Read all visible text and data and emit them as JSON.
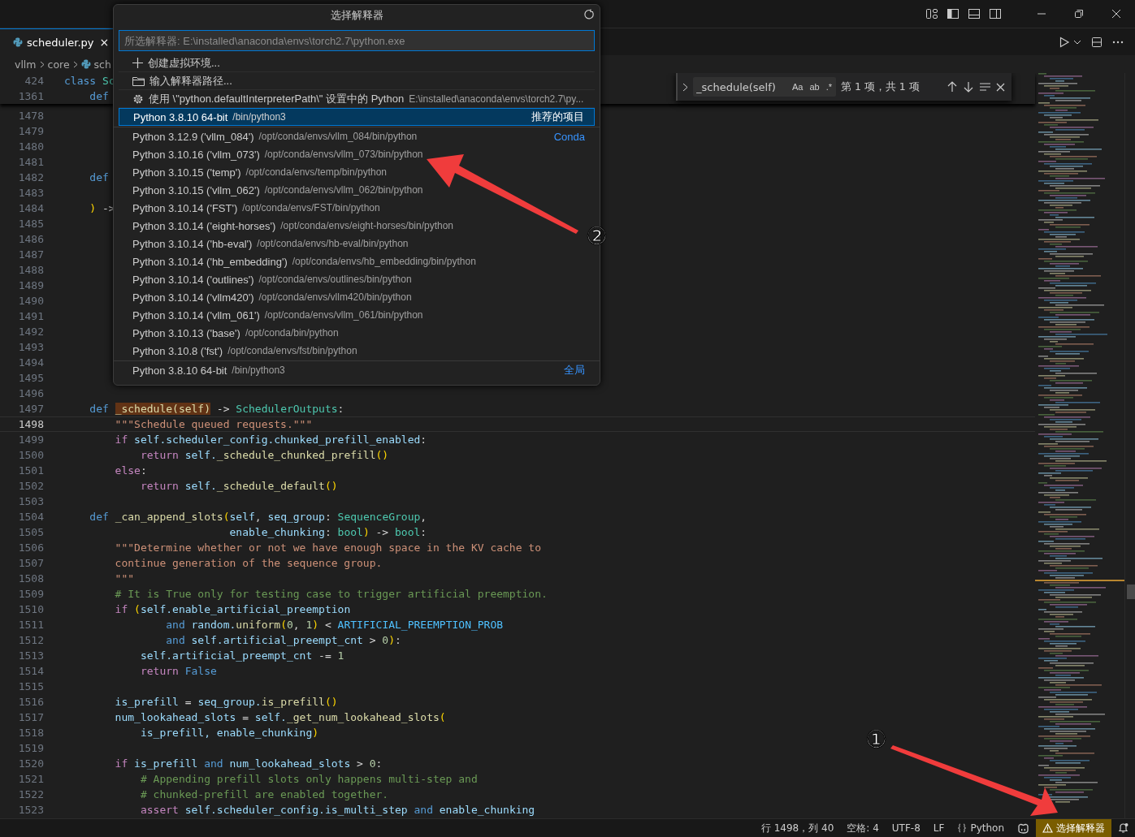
{
  "tab": {
    "label": "scheduler.py",
    "close": "×",
    "selected": true
  },
  "breadcrumbs": [
    "vllm",
    "core",
    "sch"
  ],
  "sticky": [
    {
      "n": "424",
      "tokens": [
        {
          "text": "class ",
          "kind": "kw"
        },
        {
          "text": "Sc",
          "kind": "cls"
        }
      ]
    },
    {
      "n": "1361",
      "tokens": [
        {
          "text": "    def",
          "kind": "kw"
        }
      ]
    }
  ],
  "code": {
    "lines": [
      {
        "n": "1478",
        "selected": false
      },
      {
        "n": "1479",
        "selected": false
      },
      {
        "n": "1480",
        "selected": false
      },
      {
        "n": "1481",
        "selected": false
      },
      {
        "n": "1482",
        "selected": false,
        "tokens": [
          {
            "text": "    def",
            "kind": "kw"
          }
        ]
      },
      {
        "n": "1483",
        "selected": false
      },
      {
        "n": "1484",
        "selected": false,
        "tokens": [
          {
            "text": "    )",
            "kind": "paren"
          },
          {
            "text": " ->",
            "kind": "p"
          }
        ]
      },
      {
        "n": "1485",
        "selected": false
      },
      {
        "n": "1486",
        "selected": false
      },
      {
        "n": "1487",
        "selected": false
      },
      {
        "n": "1488",
        "selected": false
      },
      {
        "n": "1489",
        "selected": false
      },
      {
        "n": "1490",
        "selected": false
      },
      {
        "n": "1491",
        "selected": false
      },
      {
        "n": "1492",
        "selected": false
      },
      {
        "n": "1493",
        "selected": false
      },
      {
        "n": "1494",
        "selected": false
      },
      {
        "n": "1495",
        "selected": false
      },
      {
        "n": "1496",
        "selected": false
      },
      {
        "n": "1497",
        "selected": false,
        "tokens": [
          {
            "text": "    def ",
            "kind": "kw"
          },
          {
            "text": "_schedule(self)",
            "kind": "match"
          },
          {
            "text": " -> ",
            "kind": "p"
          },
          {
            "text": "SchedulerOutputs",
            "kind": "cls"
          },
          {
            "text": ":",
            "kind": "p"
          }
        ]
      },
      {
        "n": "1498",
        "selected": true,
        "tokens": [
          {
            "text": "        \"\"\"Schedule queued requests.\"\"\"",
            "kind": "str"
          }
        ]
      },
      {
        "n": "1499",
        "selected": false,
        "tokens": [
          {
            "text": "        if",
            "kind": "ctl"
          },
          {
            "text": " self.scheduler_config.chunked_prefill_enabled",
            "kind": "var"
          },
          {
            "text": ":",
            "kind": "p"
          }
        ]
      },
      {
        "n": "1500",
        "selected": false,
        "tokens": [
          {
            "text": "            return",
            "kind": "ctl"
          },
          {
            "text": " self.",
            "kind": "var"
          },
          {
            "text": "_schedule_chunked_prefill",
            "kind": "fn"
          },
          {
            "text": "()",
            "kind": "paren"
          }
        ]
      },
      {
        "n": "1501",
        "selected": false,
        "tokens": [
          {
            "text": "        else",
            "kind": "ctl"
          },
          {
            "text": ":",
            "kind": "p"
          }
        ]
      },
      {
        "n": "1502",
        "selected": false,
        "tokens": [
          {
            "text": "            return",
            "kind": "ctl"
          },
          {
            "text": " self.",
            "kind": "var"
          },
          {
            "text": "_schedule_default",
            "kind": "fn"
          },
          {
            "text": "()",
            "kind": "paren"
          }
        ]
      },
      {
        "n": "1503",
        "selected": false
      },
      {
        "n": "1504",
        "selected": false,
        "tokens": [
          {
            "text": "    def ",
            "kind": "kw"
          },
          {
            "text": "_can_append_slots",
            "kind": "fn"
          },
          {
            "text": "(",
            "kind": "paren"
          },
          {
            "text": "self",
            "kind": "var"
          },
          {
            "text": ", ",
            "kind": "p"
          },
          {
            "text": "seq_group",
            "kind": "var"
          },
          {
            "text": ": ",
            "kind": "p"
          },
          {
            "text": "SequenceGroup",
            "kind": "cls"
          },
          {
            "text": ",",
            "kind": "p"
          }
        ]
      },
      {
        "n": "1505",
        "selected": false,
        "tokens": [
          {
            "text": "                          enable_chunking",
            "kind": "var"
          },
          {
            "text": ": ",
            "kind": "p"
          },
          {
            "text": "bool",
            "kind": "cls"
          },
          {
            "text": ")",
            "kind": "paren"
          },
          {
            "text": " -> ",
            "kind": "p"
          },
          {
            "text": "bool",
            "kind": "cls"
          },
          {
            "text": ":",
            "kind": "p"
          }
        ]
      },
      {
        "n": "1506",
        "selected": false,
        "tokens": [
          {
            "text": "        \"\"\"Determine whether or not we have enough space in the KV cache to",
            "kind": "str"
          }
        ]
      },
      {
        "n": "1507",
        "selected": false,
        "tokens": [
          {
            "text": "        continue generation of the sequence group.",
            "kind": "str"
          }
        ]
      },
      {
        "n": "1508",
        "selected": false,
        "tokens": [
          {
            "text": "        \"\"\"",
            "kind": "str"
          }
        ]
      },
      {
        "n": "1509",
        "selected": false,
        "tokens": [
          {
            "text": "        # It is True only for testing case to trigger artificial preemption.",
            "kind": "cm"
          }
        ]
      },
      {
        "n": "1510",
        "selected": false,
        "tokens": [
          {
            "text": "        if ",
            "kind": "ctl"
          },
          {
            "text": "(",
            "kind": "paren"
          },
          {
            "text": "self.enable_artificial_preemption",
            "kind": "var"
          }
        ]
      },
      {
        "n": "1511",
        "selected": false,
        "tokens": [
          {
            "text": "                and ",
            "kind": "kw"
          },
          {
            "text": "random.",
            "kind": "var"
          },
          {
            "text": "uniform",
            "kind": "fn"
          },
          {
            "text": "(",
            "kind": "paren"
          },
          {
            "text": "0",
            "kind": "num"
          },
          {
            "text": ", ",
            "kind": "p"
          },
          {
            "text": "1",
            "kind": "num"
          },
          {
            "text": ")",
            "kind": "paren"
          },
          {
            "text": " < ",
            "kind": "p"
          },
          {
            "text": "ARTIFICIAL_PREEMPTION_PROB",
            "kind": "const"
          }
        ]
      },
      {
        "n": "1512",
        "selected": false,
        "tokens": [
          {
            "text": "                and ",
            "kind": "kw"
          },
          {
            "text": "self.artificial_preempt_cnt",
            "kind": "var"
          },
          {
            "text": " > ",
            "kind": "p"
          },
          {
            "text": "0",
            "kind": "num"
          },
          {
            "text": ")",
            "kind": "paren"
          },
          {
            "text": ":",
            "kind": "p"
          }
        ]
      },
      {
        "n": "1513",
        "selected": false,
        "tokens": [
          {
            "text": "            self.artificial_preempt_cnt",
            "kind": "var"
          },
          {
            "text": " -= ",
            "kind": "p"
          },
          {
            "text": "1",
            "kind": "num"
          }
        ]
      },
      {
        "n": "1514",
        "selected": false,
        "tokens": [
          {
            "text": "            return ",
            "kind": "ctl"
          },
          {
            "text": "False",
            "kind": "kw"
          }
        ]
      },
      {
        "n": "1515",
        "selected": false
      },
      {
        "n": "1516",
        "selected": false,
        "tokens": [
          {
            "text": "        is_prefill",
            "kind": "var"
          },
          {
            "text": " = ",
            "kind": "p"
          },
          {
            "text": "seq_group.",
            "kind": "var"
          },
          {
            "text": "is_prefill",
            "kind": "fn"
          },
          {
            "text": "()",
            "kind": "paren"
          }
        ]
      },
      {
        "n": "1517",
        "selected": false,
        "tokens": [
          {
            "text": "        num_lookahead_slots",
            "kind": "var"
          },
          {
            "text": " = ",
            "kind": "p"
          },
          {
            "text": "self.",
            "kind": "var"
          },
          {
            "text": "_get_num_lookahead_slots",
            "kind": "fn"
          },
          {
            "text": "(",
            "kind": "paren"
          }
        ]
      },
      {
        "n": "1518",
        "selected": false,
        "tokens": [
          {
            "text": "            is_prefill, enable_chunking",
            "kind": "var"
          },
          {
            "text": ")",
            "kind": "paren"
          }
        ]
      },
      {
        "n": "1519",
        "selected": false
      },
      {
        "n": "1520",
        "selected": false,
        "tokens": [
          {
            "text": "        if ",
            "kind": "ctl"
          },
          {
            "text": "is_prefill ",
            "kind": "var"
          },
          {
            "text": "and",
            "kind": "kw"
          },
          {
            "text": " num_lookahead_slots",
            "kind": "var"
          },
          {
            "text": " > ",
            "kind": "p"
          },
          {
            "text": "0",
            "kind": "num"
          },
          {
            "text": ":",
            "kind": "p"
          }
        ]
      },
      {
        "n": "1521",
        "selected": false,
        "tokens": [
          {
            "text": "            # Appending prefill slots only happens multi-step and",
            "kind": "cm"
          }
        ]
      },
      {
        "n": "1522",
        "selected": false,
        "tokens": [
          {
            "text": "            # chunked-prefill are enabled together.",
            "kind": "cm"
          }
        ]
      },
      {
        "n": "1523",
        "selected": false,
        "tokens": [
          {
            "text": "            assert",
            "kind": "ctl"
          },
          {
            "text": " self.scheduler_config.is_multi_step ",
            "kind": "var"
          },
          {
            "text": "and",
            "kind": "kw"
          },
          {
            "text": " enable_chunking",
            "kind": "var"
          }
        ]
      }
    ]
  },
  "find": {
    "value": "_schedule(self)",
    "options": [
      "Aa",
      "ab",
      ".*"
    ],
    "result": "第 1 项，共 1 项"
  },
  "quick_pick": {
    "title": "选择解释器",
    "placeholder": "所选解释器: E:\\installed\\anaconda\\envs\\torch2.7\\python.exe",
    "actions": [
      {
        "kind": "create",
        "label": "创建虚拟环境..."
      },
      {
        "kind": "browse",
        "label": "输入解释器路径..."
      },
      {
        "kind": "setting",
        "label": "使用 \\\"python.defaultInterpreterPath\\\" 设置中的 Python",
        "detail": "E:\\installed\\anaconda\\envs\\torch2.7\\py..."
      }
    ],
    "groups": [
      {
        "badge": "推荐的项目",
        "items": [
          {
            "label": "Python 3.8.10 64-bit",
            "detail": "/bin/python3",
            "selected": true
          }
        ]
      },
      {
        "badge": "Conda",
        "items": [
          {
            "label": "Python 3.12.9 ('vllm_084')",
            "detail": "/opt/conda/envs/vllm_084/bin/python",
            "selected": false
          },
          {
            "label": "Python 3.10.16 ('vllm_073')",
            "detail": "/opt/conda/envs/vllm_073/bin/python",
            "selected": false
          },
          {
            "label": "Python 3.10.15 ('temp')",
            "detail": "/opt/conda/envs/temp/bin/python",
            "selected": false
          },
          {
            "label": "Python 3.10.15 ('vllm_062')",
            "detail": "/opt/conda/envs/vllm_062/bin/python",
            "selected": false
          },
          {
            "label": "Python 3.10.14 ('FST')",
            "detail": "/opt/conda/envs/FST/bin/python",
            "selected": false
          },
          {
            "label": "Python 3.10.14 ('eight-horses')",
            "detail": "/opt/conda/envs/eight-horses/bin/python",
            "selected": false
          },
          {
            "label": "Python 3.10.14 ('hb-eval')",
            "detail": "/opt/conda/envs/hb-eval/bin/python",
            "selected": false
          },
          {
            "label": "Python 3.10.14 ('hb_embedding')",
            "detail": "/opt/conda/envs/hb_embedding/bin/python",
            "selected": false
          },
          {
            "label": "Python 3.10.14 ('outlines')",
            "detail": "/opt/conda/envs/outlines/bin/python",
            "selected": false
          },
          {
            "label": "Python 3.10.14 ('vllm420')",
            "detail": "/opt/conda/envs/vllm420/bin/python",
            "selected": false
          },
          {
            "label": "Python 3.10.14 ('vllm_061')",
            "detail": "/opt/conda/envs/vllm_061/bin/python",
            "selected": false
          },
          {
            "label": "Python 3.10.13 ('base')",
            "detail": "/opt/conda/bin/python",
            "selected": false
          },
          {
            "label": "Python 3.10.8 ('fst')",
            "detail": "/opt/conda/envs/fst/bin/python",
            "selected": false
          }
        ]
      },
      {
        "badge": "全局",
        "items": [
          {
            "label": "Python 3.8.10 64-bit",
            "detail": "/bin/python3",
            "selected": false
          }
        ]
      }
    ]
  },
  "status_bar": {
    "items": [
      {
        "kind": "text",
        "label": "行 1498，列 40"
      },
      {
        "kind": "text",
        "label": "空格: 4"
      },
      {
        "kind": "text",
        "label": "UTF-8"
      },
      {
        "kind": "text",
        "label": "LF"
      },
      {
        "kind": "language",
        "label": "Python"
      },
      {
        "kind": "copilot"
      },
      {
        "kind": "warning",
        "label": "选择解释器"
      },
      {
        "kind": "bell"
      }
    ]
  },
  "annotations": [
    {
      "label": "②"
    },
    {
      "label": "①"
    }
  ]
}
